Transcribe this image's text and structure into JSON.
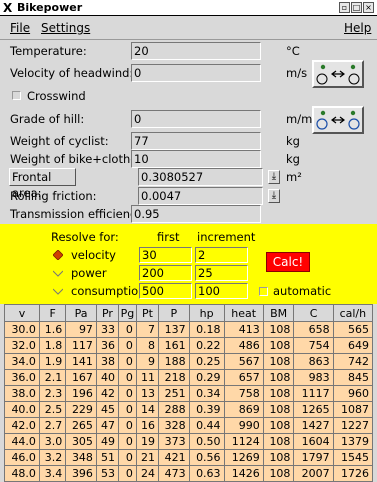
{
  "window": {
    "title": "Bikepower",
    "icon": "x-logo-icon"
  },
  "menu": {
    "file": "File",
    "settings": "Settings",
    "help": "Help"
  },
  "fields": {
    "temperature": {
      "label": "Temperature:",
      "value": "20",
      "unit": "°C"
    },
    "headwind": {
      "label": "Velocity of headwind:",
      "value": "0",
      "unit": "m/s"
    },
    "crosswind": {
      "label": "Crosswind",
      "checked": false
    },
    "grade": {
      "label": "Grade of hill:",
      "value": "0",
      "unit": "m/m"
    },
    "weight_cyclist": {
      "label": "Weight of cyclist:",
      "value": "77",
      "unit": "kg"
    },
    "weight_bike": {
      "label": "Weight of bike+clothes:",
      "value": "10",
      "unit": "kg"
    },
    "frontal_area": {
      "label": "Frontal area:",
      "value": "0.3080527",
      "unit": "m²"
    },
    "rolling_friction": {
      "label": "Rolling friction:",
      "value": "0.0047"
    },
    "transmission": {
      "label": "Transmission efficiency:",
      "value": "0.95"
    }
  },
  "resolve": {
    "title": "Resolve for:",
    "col_first": "first",
    "col_increment": "increment",
    "rows": [
      {
        "label": "velocity",
        "first": "30",
        "increment": "2",
        "selected": true
      },
      {
        "label": "power",
        "first": "200",
        "increment": "25",
        "selected": false
      },
      {
        "label": "consumption",
        "first": "500",
        "increment": "100",
        "selected": false
      }
    ],
    "calc_label": "Calc!",
    "automatic_label": "automatic"
  },
  "table": {
    "headers": [
      "v",
      "F",
      "Pa",
      "Pr",
      "Pg",
      "Pt",
      "P",
      "hp",
      "heat",
      "BM",
      "C",
      "cal/h"
    ],
    "rows": [
      [
        "30.0",
        "1.6",
        "97",
        "33",
        "0",
        "7",
        "137",
        "0.18",
        "413",
        "108",
        "658",
        "565"
      ],
      [
        "32.0",
        "1.8",
        "117",
        "36",
        "0",
        "8",
        "161",
        "0.22",
        "486",
        "108",
        "754",
        "649"
      ],
      [
        "34.0",
        "1.9",
        "141",
        "38",
        "0",
        "9",
        "188",
        "0.25",
        "567",
        "108",
        "863",
        "742"
      ],
      [
        "36.0",
        "2.1",
        "167",
        "40",
        "0",
        "11",
        "218",
        "0.29",
        "657",
        "108",
        "983",
        "845"
      ],
      [
        "38.0",
        "2.3",
        "196",
        "42",
        "0",
        "13",
        "251",
        "0.34",
        "758",
        "108",
        "1117",
        "960"
      ],
      [
        "40.0",
        "2.5",
        "229",
        "45",
        "0",
        "14",
        "288",
        "0.39",
        "869",
        "108",
        "1265",
        "1087"
      ],
      [
        "42.0",
        "2.7",
        "265",
        "47",
        "0",
        "16",
        "328",
        "0.44",
        "990",
        "108",
        "1427",
        "1227"
      ],
      [
        "44.0",
        "3.0",
        "305",
        "49",
        "0",
        "19",
        "373",
        "0.50",
        "1124",
        "108",
        "1604",
        "1379"
      ],
      [
        "46.0",
        "3.2",
        "348",
        "51",
        "0",
        "21",
        "421",
        "0.56",
        "1269",
        "108",
        "1797",
        "1545"
      ],
      [
        "48.0",
        "3.4",
        "396",
        "53",
        "0",
        "24",
        "473",
        "0.63",
        "1426",
        "108",
        "2007",
        "1726"
      ]
    ]
  }
}
